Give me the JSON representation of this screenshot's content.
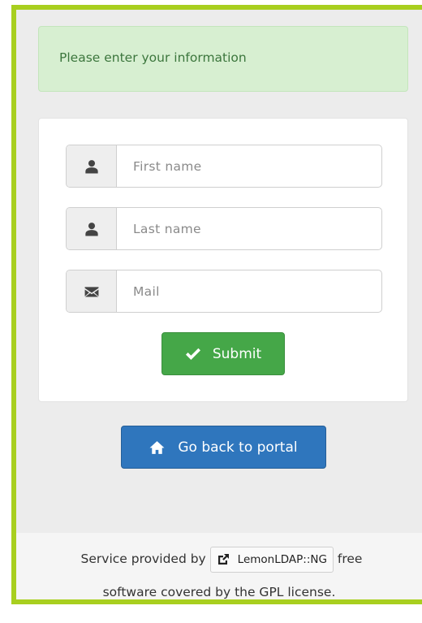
{
  "alert": {
    "text": "Please enter your information"
  },
  "form": {
    "firstname": {
      "placeholder": "First name",
      "value": ""
    },
    "lastname": {
      "placeholder": "Last name",
      "value": ""
    },
    "mail": {
      "placeholder": "Mail",
      "value": ""
    },
    "submit_label": "Submit"
  },
  "portal": {
    "back_label": "Go back to portal"
  },
  "footer": {
    "prefix": "Service provided by",
    "link_label": "LemonLDAP::NG",
    "suffix": "free",
    "line2": "software covered by the GPL license."
  },
  "colors": {
    "frame_accent": "#a8cf1f",
    "alert_bg": "#d7efd1",
    "alert_text": "#3c763d",
    "submit_bg": "#45a748",
    "portal_bg": "#2f76bd"
  },
  "icons": {
    "firstname": "user-icon",
    "lastname": "user-icon",
    "mail": "envelope-icon",
    "submit": "check-icon",
    "portal": "home-icon",
    "link": "external-link-icon"
  }
}
